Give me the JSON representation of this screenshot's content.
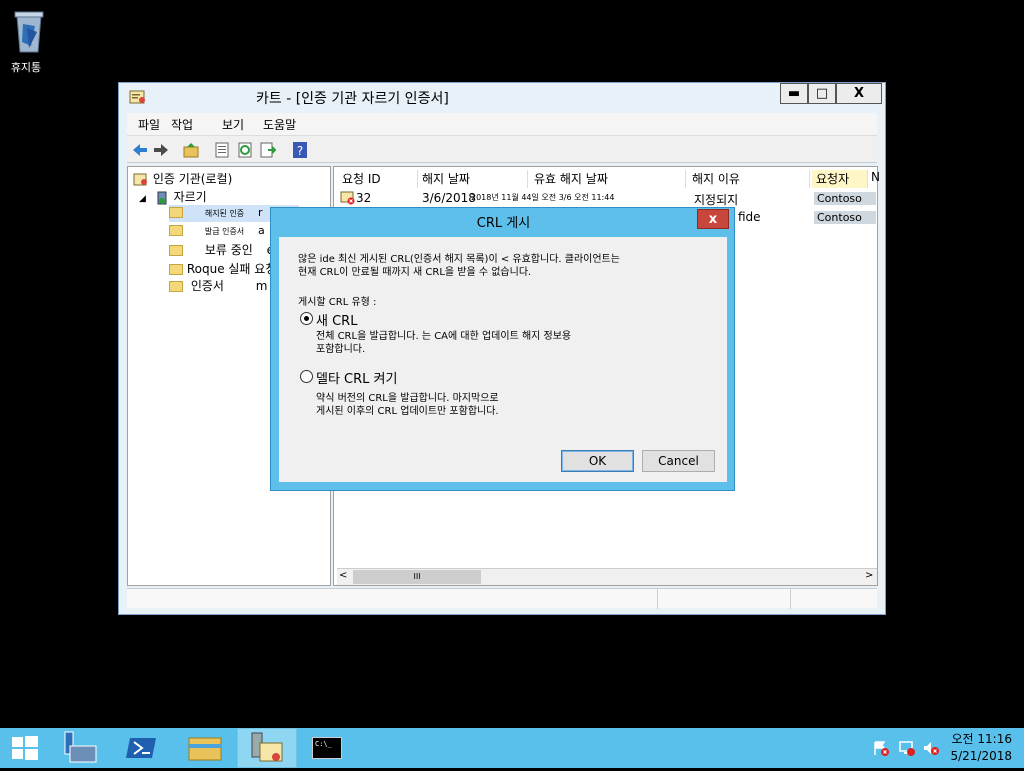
{
  "desktop": {
    "recycle_bin_label": "휴지통"
  },
  "window": {
    "title": "카트 - [인증 기관 자르기 인증서]",
    "minimize": "▬",
    "maximize": "□",
    "close": "X",
    "menu": [
      "파일",
      "작업",
      "보기",
      "도움말"
    ]
  },
  "tree": {
    "root": "인증 기관(로컬)",
    "ca": "자르기",
    "items": [
      "해지된 인증",
      "발급 인증서",
      "보류 중인",
      "Roque 실패 요청",
      "인증서"
    ],
    "suffixes": [
      "r",
      "a",
      "e",
      "",
      "m"
    ]
  },
  "list": {
    "columns": [
      "요청 ID",
      "해지 날짜",
      "유효 해지 날짜",
      "해지 이유",
      "요청자",
      "N"
    ],
    "row1": {
      "id": "32",
      "revoke_date": "3/6/2018",
      "effective": "2018년 11월 44일 오전 3/6 오전 11:44",
      "reason": "지정되지",
      "requester": "Contoso"
    },
    "row2": {
      "reason_tail": "fide",
      "requester": "Contoso"
    },
    "scroll_thumb": "III"
  },
  "dialog": {
    "title": "CRL 게시",
    "close": "x",
    "desc_line1": "않은 ide 최신 게시된 CRL(인증서 해지 목록)이 < 유효합니다. 클라이언트는",
    "desc_line2": "현재 CRL이 만료될 때까지 새 CRL을 받을 수 없습니다.",
    "type_label": "게시할 CRL 유형 :",
    "opt1_label": "새 CRL",
    "opt1_desc1": "전체 CRL을 발급합니다. 는 CA에 대한 업데이트 해지 정보용",
    "opt1_desc2": "포함합니다.",
    "opt2_label": "델타 CRL 켜기",
    "opt2_desc1": "약식 버전의 CRL을 발급합니다. 마지막으로",
    "opt2_desc2": "게시된 이후의 CRL 업데이트만 포함합니다.",
    "ok": "OK",
    "cancel": "Cancel"
  },
  "taskbar": {
    "clock_line1": "오전 11:16",
    "clock_line2": "5/21/2018",
    "cmd_glyph": "C:\\_"
  }
}
